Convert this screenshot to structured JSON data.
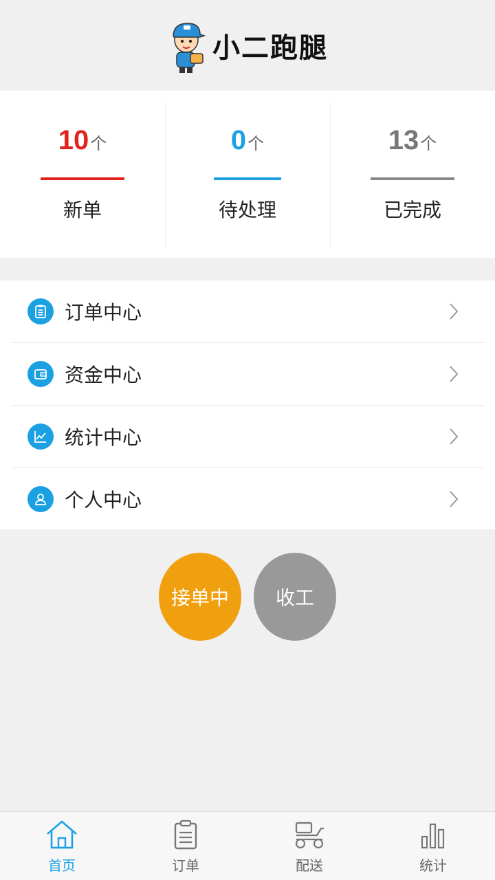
{
  "header": {
    "brand": "小二跑腿"
  },
  "stats": [
    {
      "value": "10",
      "unit": "个",
      "label": "新单",
      "color": "#e0231d"
    },
    {
      "value": "0",
      "unit": "个",
      "label": "待处理",
      "color": "#1ba1e2"
    },
    {
      "value": "13",
      "unit": "个",
      "label": "已完成",
      "color": "#777777"
    }
  ],
  "menu": [
    {
      "label": "订单中心",
      "icon": "clipboard-icon"
    },
    {
      "label": "资金中心",
      "icon": "wallet-icon"
    },
    {
      "label": "统计中心",
      "icon": "chart-icon"
    },
    {
      "label": "个人中心",
      "icon": "user-icon"
    }
  ],
  "actions": {
    "accepting": "接单中",
    "stop": "收工"
  },
  "tabs": [
    {
      "label": "首页",
      "icon": "home-icon",
      "active": true
    },
    {
      "label": "订单",
      "icon": "clipboard-icon",
      "active": false
    },
    {
      "label": "配送",
      "icon": "scooter-icon",
      "active": false
    },
    {
      "label": "统计",
      "icon": "bar-chart-icon",
      "active": false
    }
  ],
  "colors": {
    "accent": "#1ba1e2",
    "orange": "#f0a00e",
    "gray": "#999999",
    "red": "#e0231d"
  }
}
